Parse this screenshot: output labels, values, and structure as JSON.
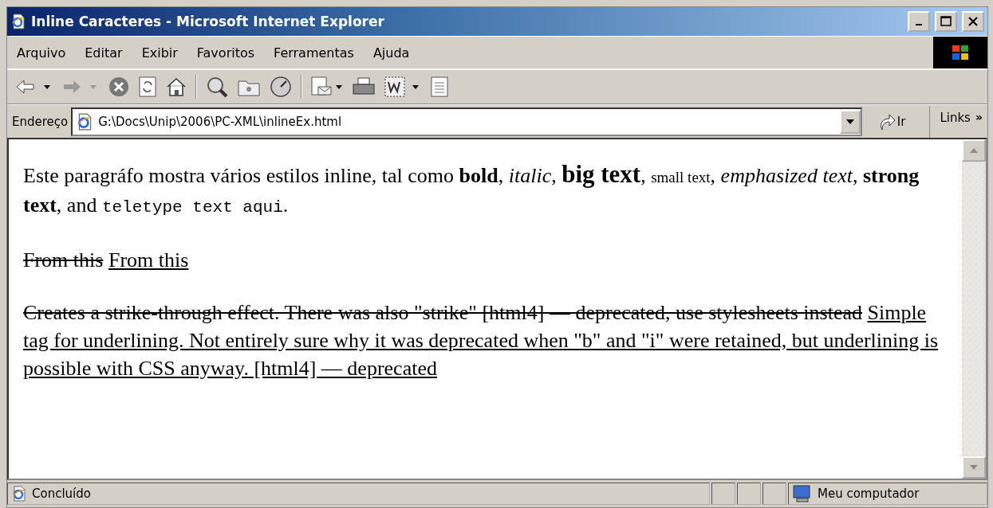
{
  "window": {
    "title": "Inline Caracteres - Microsoft Internet Explorer"
  },
  "menu": [
    "Arquivo",
    "Editar",
    "Exibir",
    "Favoritos",
    "Ferramentas",
    "Ajuda"
  ],
  "address": {
    "label": "Endereço",
    "value": "G:\\Docs\\Unip\\2006\\PC-XML\\inlineEx.html",
    "go": "Ir",
    "links": "Links",
    "more": "»"
  },
  "paragraphs": [
    [
      {
        "kind": "plain",
        "text": "Este paragráfo mostra vários estilos inline, tal como "
      },
      {
        "kind": "bold",
        "text": "bold"
      },
      {
        "kind": "plain",
        "text": ", "
      },
      {
        "kind": "italic",
        "text": "italic"
      },
      {
        "kind": "plain",
        "text": ", "
      },
      {
        "kind": "big",
        "text": "big text"
      },
      {
        "kind": "plain",
        "text": ", "
      },
      {
        "kind": "small",
        "text": "small text"
      },
      {
        "kind": "plain",
        "text": ", "
      },
      {
        "kind": "italic",
        "text": "emphasized text"
      },
      {
        "kind": "plain",
        "text": ", "
      },
      {
        "kind": "bold",
        "text": "strong text"
      },
      {
        "kind": "plain",
        "text": ", and "
      },
      {
        "kind": "mono",
        "text": "teletype text aqui"
      },
      {
        "kind": "plain",
        "text": "."
      }
    ],
    [
      {
        "kind": "strike",
        "text": "From this"
      },
      {
        "kind": "underline",
        "text": "From this"
      }
    ],
    [
      {
        "kind": "strike",
        "text": "Creates a strike-through effect. There was also \"strike\" [html4] — deprecated, use stylesheets instead"
      },
      {
        "kind": "underline",
        "text": "Simple tag for underlining. Not entirely sure why it was deprecated when \"b\" and \"i\" were retained, but underlining is possible with CSS anyway. [html4] — deprecated"
      }
    ]
  ],
  "status": {
    "text": "Concluído",
    "zone": "Meu computador"
  }
}
